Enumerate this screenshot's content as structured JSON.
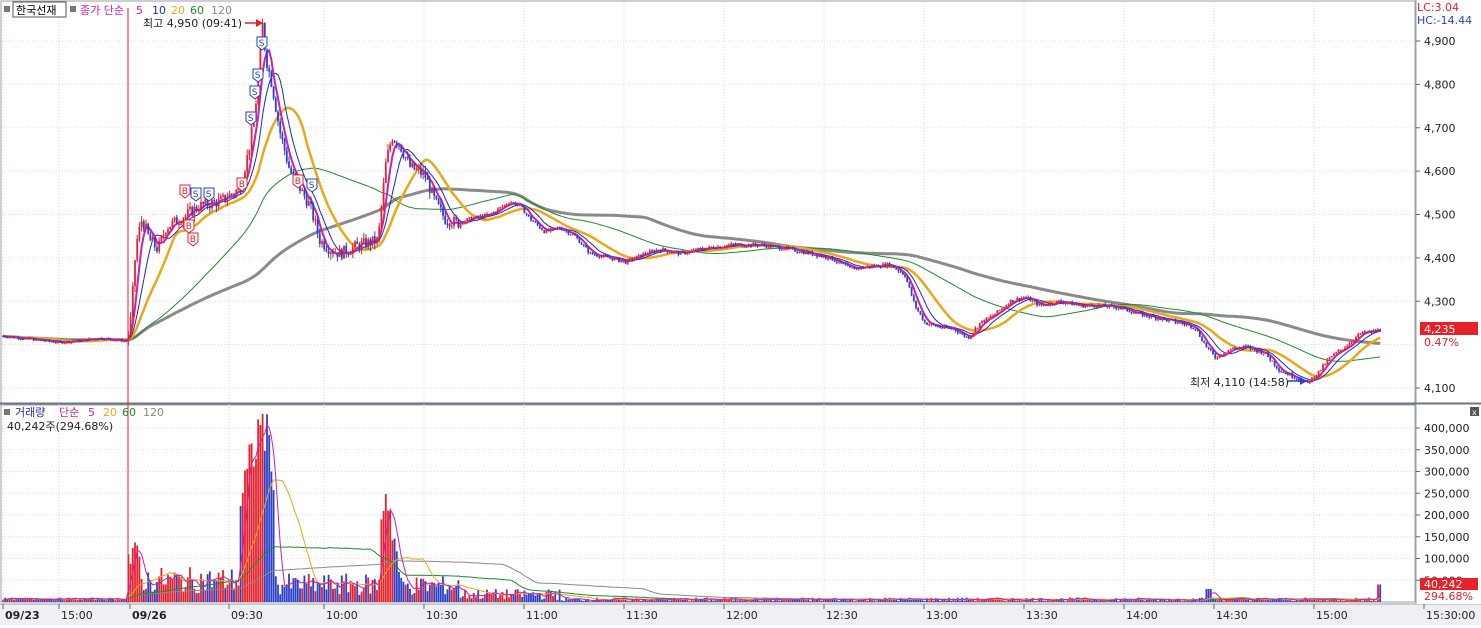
{
  "colors": {
    "up": "#e8202a",
    "down": "#2b3fc8",
    "ma5": "#c81fb4",
    "ma10": "#1c2bb8",
    "ma20": "#e8a818",
    "ma60": "#1f8a30",
    "ma120": "#8a8a8a",
    "buy_badge": "#e8202a",
    "sell_badge": "#2040c8"
  },
  "price_panel": {
    "legend": {
      "title": "한국선재",
      "ma_label": "종가 단순",
      "periods": [
        "5",
        "10",
        "20",
        "60",
        "120"
      ]
    },
    "top_right": {
      "lc": "LC:3.04",
      "hc": "HC:-14.44"
    },
    "current_price": "4,235",
    "change_pct": "0.47%",
    "high_annotation": "최고 4,950 (09:41)",
    "low_annotation": "최저 4,110 (14:58)",
    "markers": {
      "buy": "B",
      "sell": "S"
    },
    "y_ticks": [
      "4,900",
      "4,800",
      "4,700",
      "4,600",
      "4,500",
      "4,400",
      "4,300",
      "4,100"
    ]
  },
  "volume_panel": {
    "legend": {
      "title": "거래량",
      "ma_label": "단순",
      "periods": [
        "5",
        "20",
        "60",
        "120"
      ]
    },
    "current": "40,242주(294.68%)",
    "badge_value": "40,242",
    "badge_pct": "294.68%",
    "y_ticks": [
      "400,000",
      "350,000",
      "300,000",
      "250,000",
      "200,000",
      "150,000",
      "100,000",
      "50,000"
    ]
  },
  "x_axis": {
    "labels": [
      "09/23",
      "15:00",
      "09/26",
      "09:30",
      "10:00",
      "10:30",
      "11:00",
      "11:30",
      "12:00",
      "12:30",
      "13:00",
      "13:30",
      "14:00",
      "14:30",
      "15:00",
      "15:30:00"
    ]
  },
  "chart_data": {
    "type": "candlestick",
    "title": "한국선재",
    "y_range_price": [
      4080,
      4960
    ],
    "y_range_volume": [
      0,
      430000
    ],
    "price_keypoints": [
      {
        "x": "09/23",
        "y": 4220
      },
      {
        "x": "09/23 15:00",
        "y": 4205
      },
      {
        "x": "09/26 09:00",
        "y": 4210
      },
      {
        "x": "09:05",
        "y": 4480
      },
      {
        "x": "09:10",
        "y": 4440
      },
      {
        "x": "09:20",
        "y": 4530
      },
      {
        "x": "09:30",
        "y": 4560
      },
      {
        "x": "09:36",
        "y": 4700
      },
      {
        "x": "09:41",
        "y": 4950
      },
      {
        "x": "09:45",
        "y": 4780
      },
      {
        "x": "09:50",
        "y": 4600
      },
      {
        "x": "10:00",
        "y": 4430
      },
      {
        "x": "10:10",
        "y": 4440
      },
      {
        "x": "10:20",
        "y": 4660
      },
      {
        "x": "10:30",
        "y": 4570
      },
      {
        "x": "10:40",
        "y": 4470
      },
      {
        "x": "11:00",
        "y": 4520
      },
      {
        "x": "11:30",
        "y": 4400
      },
      {
        "x": "12:00",
        "y": 4420
      },
      {
        "x": "12:30",
        "y": 4380
      },
      {
        "x": "13:00",
        "y": 4220
      },
      {
        "x": "13:20",
        "y": 4310
      },
      {
        "x": "14:00",
        "y": 4280
      },
      {
        "x": "14:30",
        "y": 4180
      },
      {
        "x": "14:58",
        "y": 4110
      },
      {
        "x": "15:10",
        "y": 4190
      },
      {
        "x": "15:20",
        "y": 4235
      }
    ],
    "high": {
      "time": "09:41",
      "value": 4950
    },
    "low": {
      "time": "14:58",
      "value": 4110
    },
    "last": 4235,
    "volume_last": 40242,
    "volume_peak": {
      "time": "09:41",
      "value": 420000
    }
  }
}
